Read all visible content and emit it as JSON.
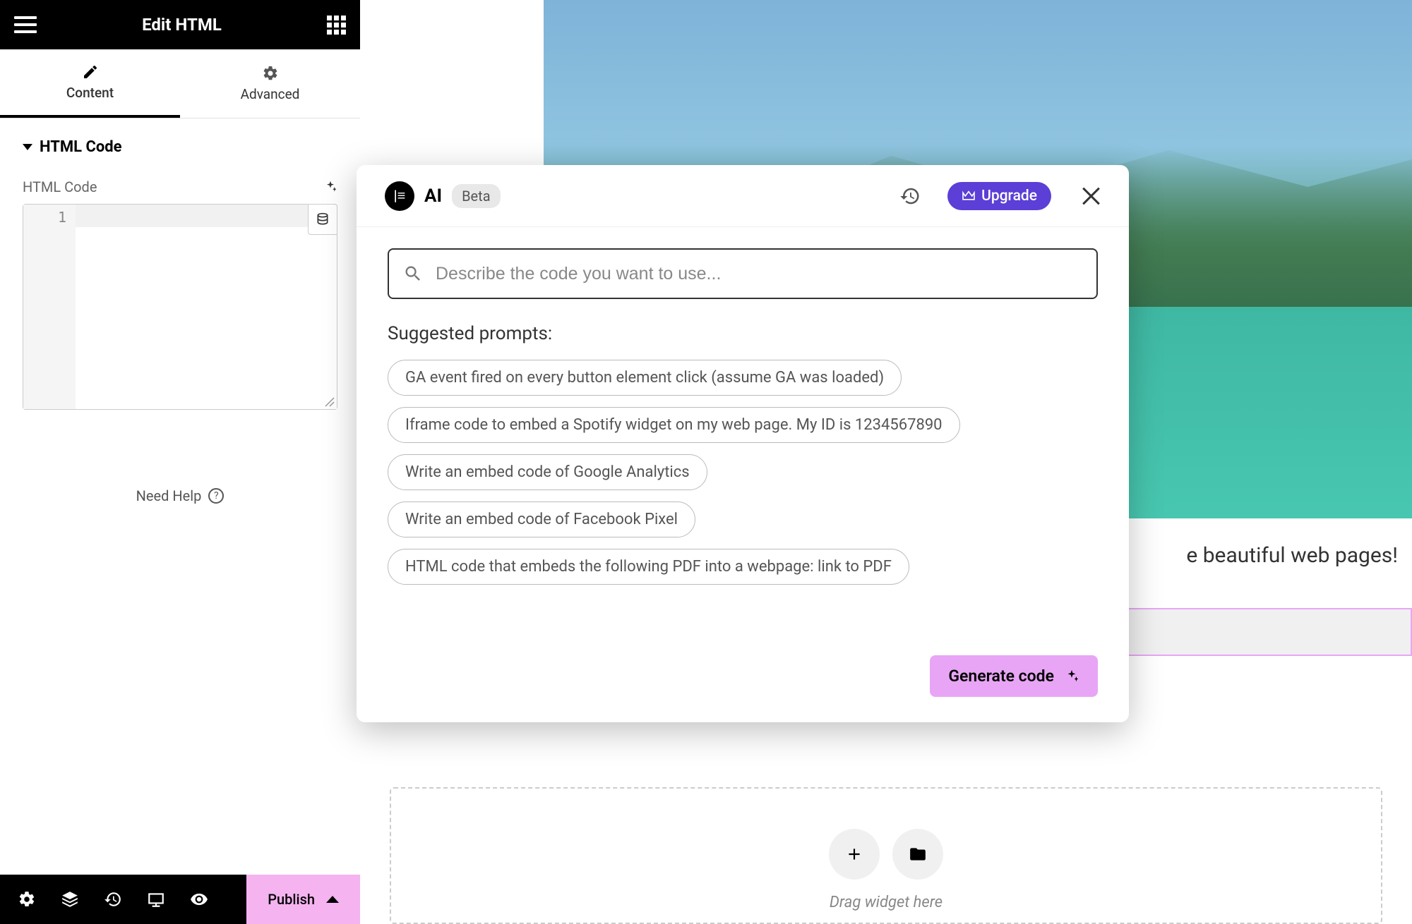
{
  "sidebar": {
    "title": "Edit HTML",
    "tabs": [
      {
        "label": "Content"
      },
      {
        "label": "Advanced"
      }
    ],
    "section_title": "HTML Code",
    "field_label": "HTML Code",
    "gutter_line": "1",
    "need_help": "Need Help",
    "help_q": "?",
    "publish": "Publish"
  },
  "canvas": {
    "hero_text": "e beautiful web pages!",
    "drop_text": "Drag widget here"
  },
  "modal": {
    "e_badge": "|≡",
    "ai_label": "AI",
    "beta": "Beta",
    "upgrade": "Upgrade",
    "placeholder": "Describe the code you want to use...",
    "suggested_title": "Suggested prompts:",
    "chips": [
      "GA event fired on every button element click (assume GA was loaded)",
      "Iframe code to embed a Spotify widget on my web page. My ID is 1234567890",
      "Write an embed code of Google Analytics",
      "Write an embed code of Facebook Pixel",
      "HTML code that embeds the following PDF into a webpage: link to PDF"
    ],
    "generate": "Generate code"
  }
}
